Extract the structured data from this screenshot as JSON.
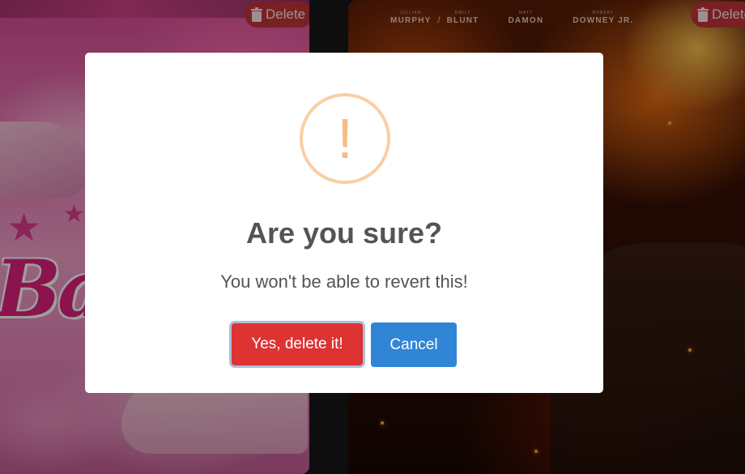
{
  "background": {
    "left_card": {
      "delete_label": "Delete",
      "poster_logo": "Ba"
    },
    "right_card": {
      "delete_label": "Delete",
      "cast": [
        {
          "first": "CILLIAN",
          "last": "MURPHY"
        },
        {
          "first": "EMILY",
          "last": "BLUNT"
        },
        {
          "first": "MATT",
          "last": "DAMON"
        },
        {
          "first": "ROBERT",
          "last": "DOWNEY JR."
        }
      ]
    }
  },
  "dialog": {
    "icon": "warning-exclamation-icon",
    "icon_glyph": "!",
    "title": "Are you sure?",
    "text": "You won't be able to revert this!",
    "confirm_label": "Yes, delete it!",
    "cancel_label": "Cancel"
  },
  "colors": {
    "confirm_button": "#dd3333",
    "cancel_button": "#3085d6",
    "warning_icon": "#f8bb86",
    "delete_chip": "#c3353c"
  }
}
